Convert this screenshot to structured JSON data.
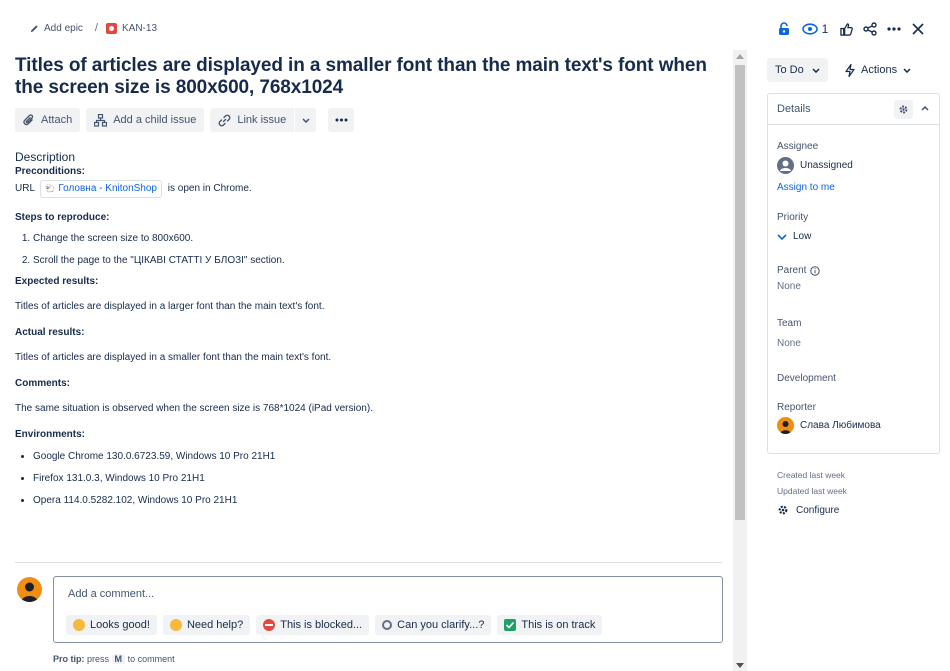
{
  "breadcrumb": {
    "add_epic": "Add epic",
    "separator": "/",
    "issue_key": "KAN-13"
  },
  "header": {
    "watch_count": "1"
  },
  "issue": {
    "title": "Titles of articles are displayed in a smaller font than the main text's font when the screen size is 800x600, 768x1024"
  },
  "toolbar": {
    "attach": "Attach",
    "add_child": "Add a child issue",
    "link_issue": "Link issue"
  },
  "description": {
    "label": "Description",
    "preconditions_h": "Preconditions:",
    "url_prefix": "URL",
    "smartlink": "Головна - KnitonShop",
    "url_suffix": "is open in Chrome.",
    "steps_h": "Steps to reproduce:",
    "steps": [
      "Change the screen size to 800x600.",
      "Scroll the page to the \"ЦІКАВІ СТАТТІ У БЛОЗІ\" section."
    ],
    "expected_h": "Expected results:",
    "expected": "Titles of articles are displayed in a larger font than the main text's font.",
    "actual_h": "Actual results:",
    "actual": "Titles of articles are displayed in a smaller font than the main text's font.",
    "comments_h": "Comments:",
    "comments": "The same situation is observed when the screen size is 768*1024 (iPad version).",
    "env_h": "Environments:",
    "envs": [
      "Google Chrome 130.0.6723.59, Windows 10 Pro 21H1",
      "Firefox 131.0.3, Windows 10 Pro 21H1",
      "Opera 114.0.5282.102, Windows 10 Pro 21H1"
    ]
  },
  "comment": {
    "placeholder": "Add a comment...",
    "chips": [
      "Looks good!",
      "Need help?",
      "This is blocked...",
      "Can you clarify...?",
      "This is on track"
    ],
    "protip_label": "Pro tip:",
    "protip_pre": "press",
    "protip_key": "M",
    "protip_post": "to comment"
  },
  "sidebar": {
    "status": "To Do",
    "actions": "Actions",
    "details_title": "Details",
    "assignee_label": "Assignee",
    "assignee_value": "Unassigned",
    "assign_to_me": "Assign to me",
    "priority_label": "Priority",
    "priority_value": "Low",
    "parent_label": "Parent",
    "parent_value": "None",
    "team_label": "Team",
    "team_value": "None",
    "development_label": "Development",
    "reporter_label": "Reporter",
    "reporter_value": "Слава Любимова",
    "created": "Created last week",
    "updated": "Updated last week",
    "configure": "Configure"
  },
  "colors": {
    "accent": "#0c66e4",
    "bug": "#e2483d",
    "avatar": "#f18d13",
    "text": "#172b4d"
  }
}
